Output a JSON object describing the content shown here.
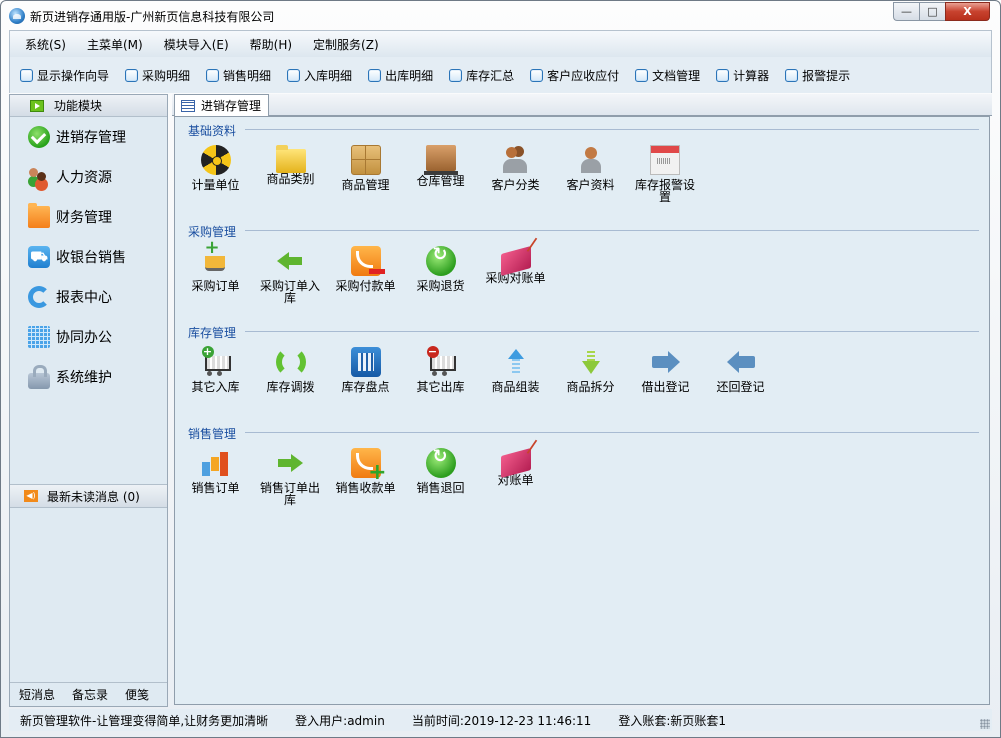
{
  "window": {
    "title": "新页进销存通用版-广州新页信息科技有限公司",
    "controls": {
      "minimize": "—",
      "maximize": "□",
      "close": "X"
    }
  },
  "menubar": [
    {
      "label": "系统(S)"
    },
    {
      "label": "主菜单(M)"
    },
    {
      "label": "模块导入(E)"
    },
    {
      "label": "帮助(H)"
    },
    {
      "label": "定制服务(Z)"
    }
  ],
  "toolbar": [
    {
      "label": "显示操作向导",
      "checked": false
    },
    {
      "label": "采购明细",
      "checked": false
    },
    {
      "label": "销售明细",
      "checked": false
    },
    {
      "label": "入库明细",
      "checked": false
    },
    {
      "label": "出库明细",
      "checked": false
    },
    {
      "label": "库存汇总",
      "checked": false
    },
    {
      "label": "客户应收应付",
      "checked": false
    },
    {
      "label": "文档管理",
      "checked": false
    },
    {
      "label": "计算器",
      "checked": false
    },
    {
      "label": "报警提示",
      "checked": false
    }
  ],
  "sidebar": {
    "header": "功能模块",
    "items": [
      {
        "label": "进销存管理",
        "icon": "check-circle-icon"
      },
      {
        "label": "人力资源",
        "icon": "people-icon"
      },
      {
        "label": "财务管理",
        "icon": "folder-icon"
      },
      {
        "label": "收银台销售",
        "icon": "cart-icon"
      },
      {
        "label": "报表中心",
        "icon": "refresh-icon"
      },
      {
        "label": "协同办公",
        "icon": "calendar-icon"
      },
      {
        "label": "系统维护",
        "icon": "lock-icon"
      }
    ],
    "messages": "最新未读消息 (0)",
    "footer": [
      "短消息",
      "备忘录",
      "便笺"
    ]
  },
  "main": {
    "tab": "进销存管理",
    "groups": [
      {
        "title": "基础资料",
        "items": [
          {
            "label": "计量单位",
            "icon": "radiation-icon"
          },
          {
            "label": "商品类别",
            "icon": "folder-icon"
          },
          {
            "label": "商品管理",
            "icon": "box-icon"
          },
          {
            "label": "仓库管理",
            "icon": "crate-icon"
          },
          {
            "label": "客户分类",
            "icon": "users-icon"
          },
          {
            "label": "客户资料",
            "icon": "user-icon"
          },
          {
            "label": "库存报警设置",
            "icon": "calendar-icon"
          }
        ]
      },
      {
        "title": "采购管理",
        "items": [
          {
            "label": "采购订单",
            "icon": "cart-add-icon"
          },
          {
            "label": "采购订单入库",
            "icon": "arrow-left-icon"
          },
          {
            "label": "采购付款单",
            "icon": "rss-minus-icon"
          },
          {
            "label": "采购退货",
            "icon": "return-icon"
          },
          {
            "label": "采购对账单",
            "icon": "book-icon"
          }
        ]
      },
      {
        "title": "库存管理",
        "items": [
          {
            "label": "其它入库",
            "icon": "cart-plus-icon"
          },
          {
            "label": "库存调拨",
            "icon": "sync-icon"
          },
          {
            "label": "库存盘点",
            "icon": "calculator-icon"
          },
          {
            "label": "其它出库",
            "icon": "cart-minus-icon"
          },
          {
            "label": "商品组装",
            "icon": "arrow-up-icon"
          },
          {
            "label": "商品拆分",
            "icon": "arrow-down-icon"
          },
          {
            "label": "借出登记",
            "icon": "arrow-right-blue-icon"
          },
          {
            "label": "还回登记",
            "icon": "arrow-left-blue-icon"
          }
        ]
      },
      {
        "title": "销售管理",
        "items": [
          {
            "label": "销售订单",
            "icon": "bar-chart-icon"
          },
          {
            "label": "销售订单出库",
            "icon": "arrow-right-icon"
          },
          {
            "label": "销售收款单",
            "icon": "rss-plus-icon"
          },
          {
            "label": "销售退回",
            "icon": "return-icon"
          },
          {
            "label": "对账单",
            "icon": "book-icon"
          }
        ]
      }
    ]
  },
  "statusbar": {
    "slogan": "新页管理软件-让管理变得简单,让财务更加清晰",
    "user": "登入用户:admin",
    "time": "当前时间:2019-12-23 11:46:11",
    "account": "登入账套:新页账套1"
  }
}
